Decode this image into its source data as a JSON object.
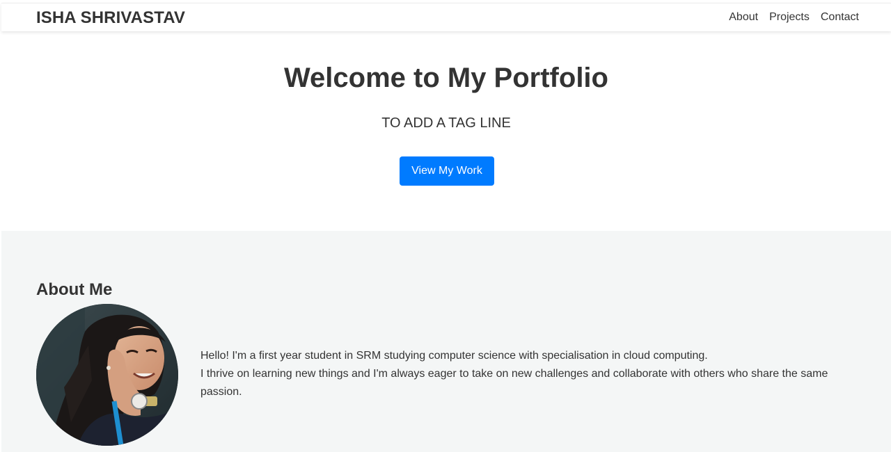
{
  "header": {
    "brand": "ISHA SHRIVASTAV",
    "nav": [
      {
        "label": "About"
      },
      {
        "label": "Projects"
      },
      {
        "label": "Contact"
      }
    ]
  },
  "hero": {
    "title": "Welcome to My Portfolio",
    "tagline": "TO ADD A TAG LINE",
    "cta_label": "View My Work"
  },
  "about": {
    "heading": "About Me",
    "paragraphs": [
      "Hello! I'm a first year student in SRM studying computer science with specialisation in cloud computing.",
      "I thrive on learning new things and I'm always eager to take on new challenges and collaborate with others who share the same passion."
    ]
  },
  "colors": {
    "accent": "#007bff",
    "text": "#333333",
    "about_bg": "#f4f6f6"
  }
}
